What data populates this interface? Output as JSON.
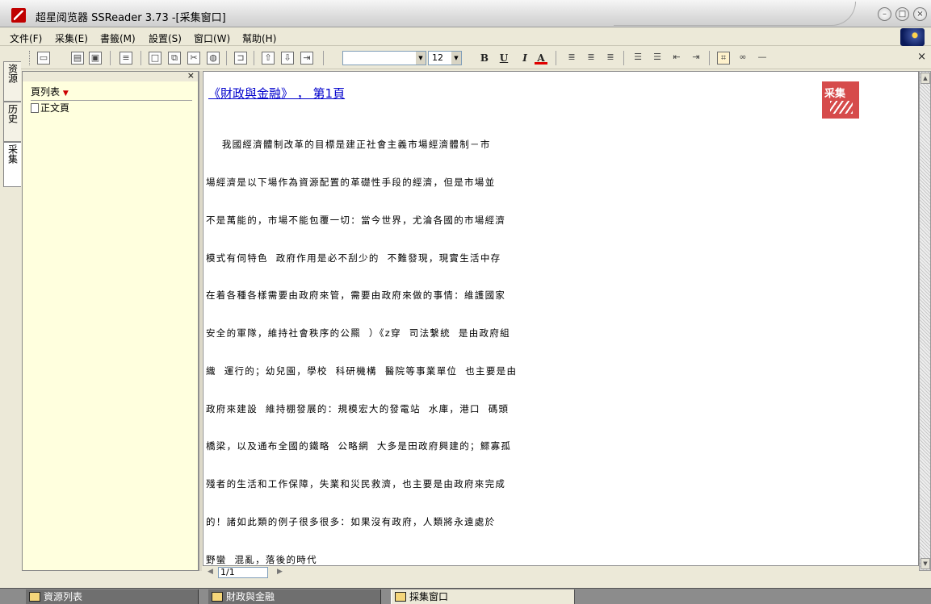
{
  "window": {
    "title": "超星阅览器 SSReader 3.73 -[采集窗口]"
  },
  "menu": {
    "items": [
      "文件(F)",
      "采集(E)",
      "書籤(M)",
      "設置(S)",
      "窗口(W)",
      "幫助(H)"
    ]
  },
  "toolbar": {
    "font_size": "12",
    "icons": [
      "open-folder-icon",
      "paste-icon",
      "save-icon",
      "table-icon",
      "new-page-icon",
      "copy-icon",
      "cut-icon",
      "globe-icon",
      "bookmark-icon",
      "arrow-up-icon",
      "arrow-down-icon",
      "goto-icon"
    ],
    "format_buttons": [
      "B",
      "U",
      "I",
      "A"
    ]
  },
  "side_tabs": [
    "资源",
    "历史",
    "采集"
  ],
  "left_panel": {
    "title": "頁列表",
    "items": [
      "正文頁"
    ]
  },
  "document": {
    "title": "《財政與金融》 ， 第1頁",
    "lines": [
      "    我國經濟體制改革的目標是建正社會主義市場經濟體制－市",
      "場經濟是以下場作為資源配置的革礎性手段的經濟，但是市場並",
      "不是萬能的，市場不能包覆一切：當今世界，尤淪各國的市場經濟",
      "模式有伺特色  政府作用是必不刮少的  不難發現，現實生活中存",
      "在着各種各樣需要由政府來管，需要由政府來做的事情：維護國家",
      "安全的軍隊，維持社會秩序的公羆  ）《z穿  司法繫統  是由政府組",
      "織  運行的；幼兒園，學校  科研機構  醫院等事業單位  也主要是由",
      "政府來建設  維持棚發展的：規模宏大的發電站  水庫，港口  碼頭",
      "橋梁，以及通布全國的鐵略  公略網  大多是田政府興建的；鰥寡孤",
      "殘者的生活和工作保障，失業和災民救濟，也主要是由政府來完成",
      "的！諸如此類的例子很多很多：如果沒有政府，人類將永遠處於",
      "野蠻  混亂，落後的時代"
    ],
    "stamp_text": "采集"
  },
  "page_nav": {
    "current": "1/1"
  },
  "taskbar": {
    "tabs": [
      "資源列表",
      "財政與金融",
      "採集窗口"
    ]
  }
}
